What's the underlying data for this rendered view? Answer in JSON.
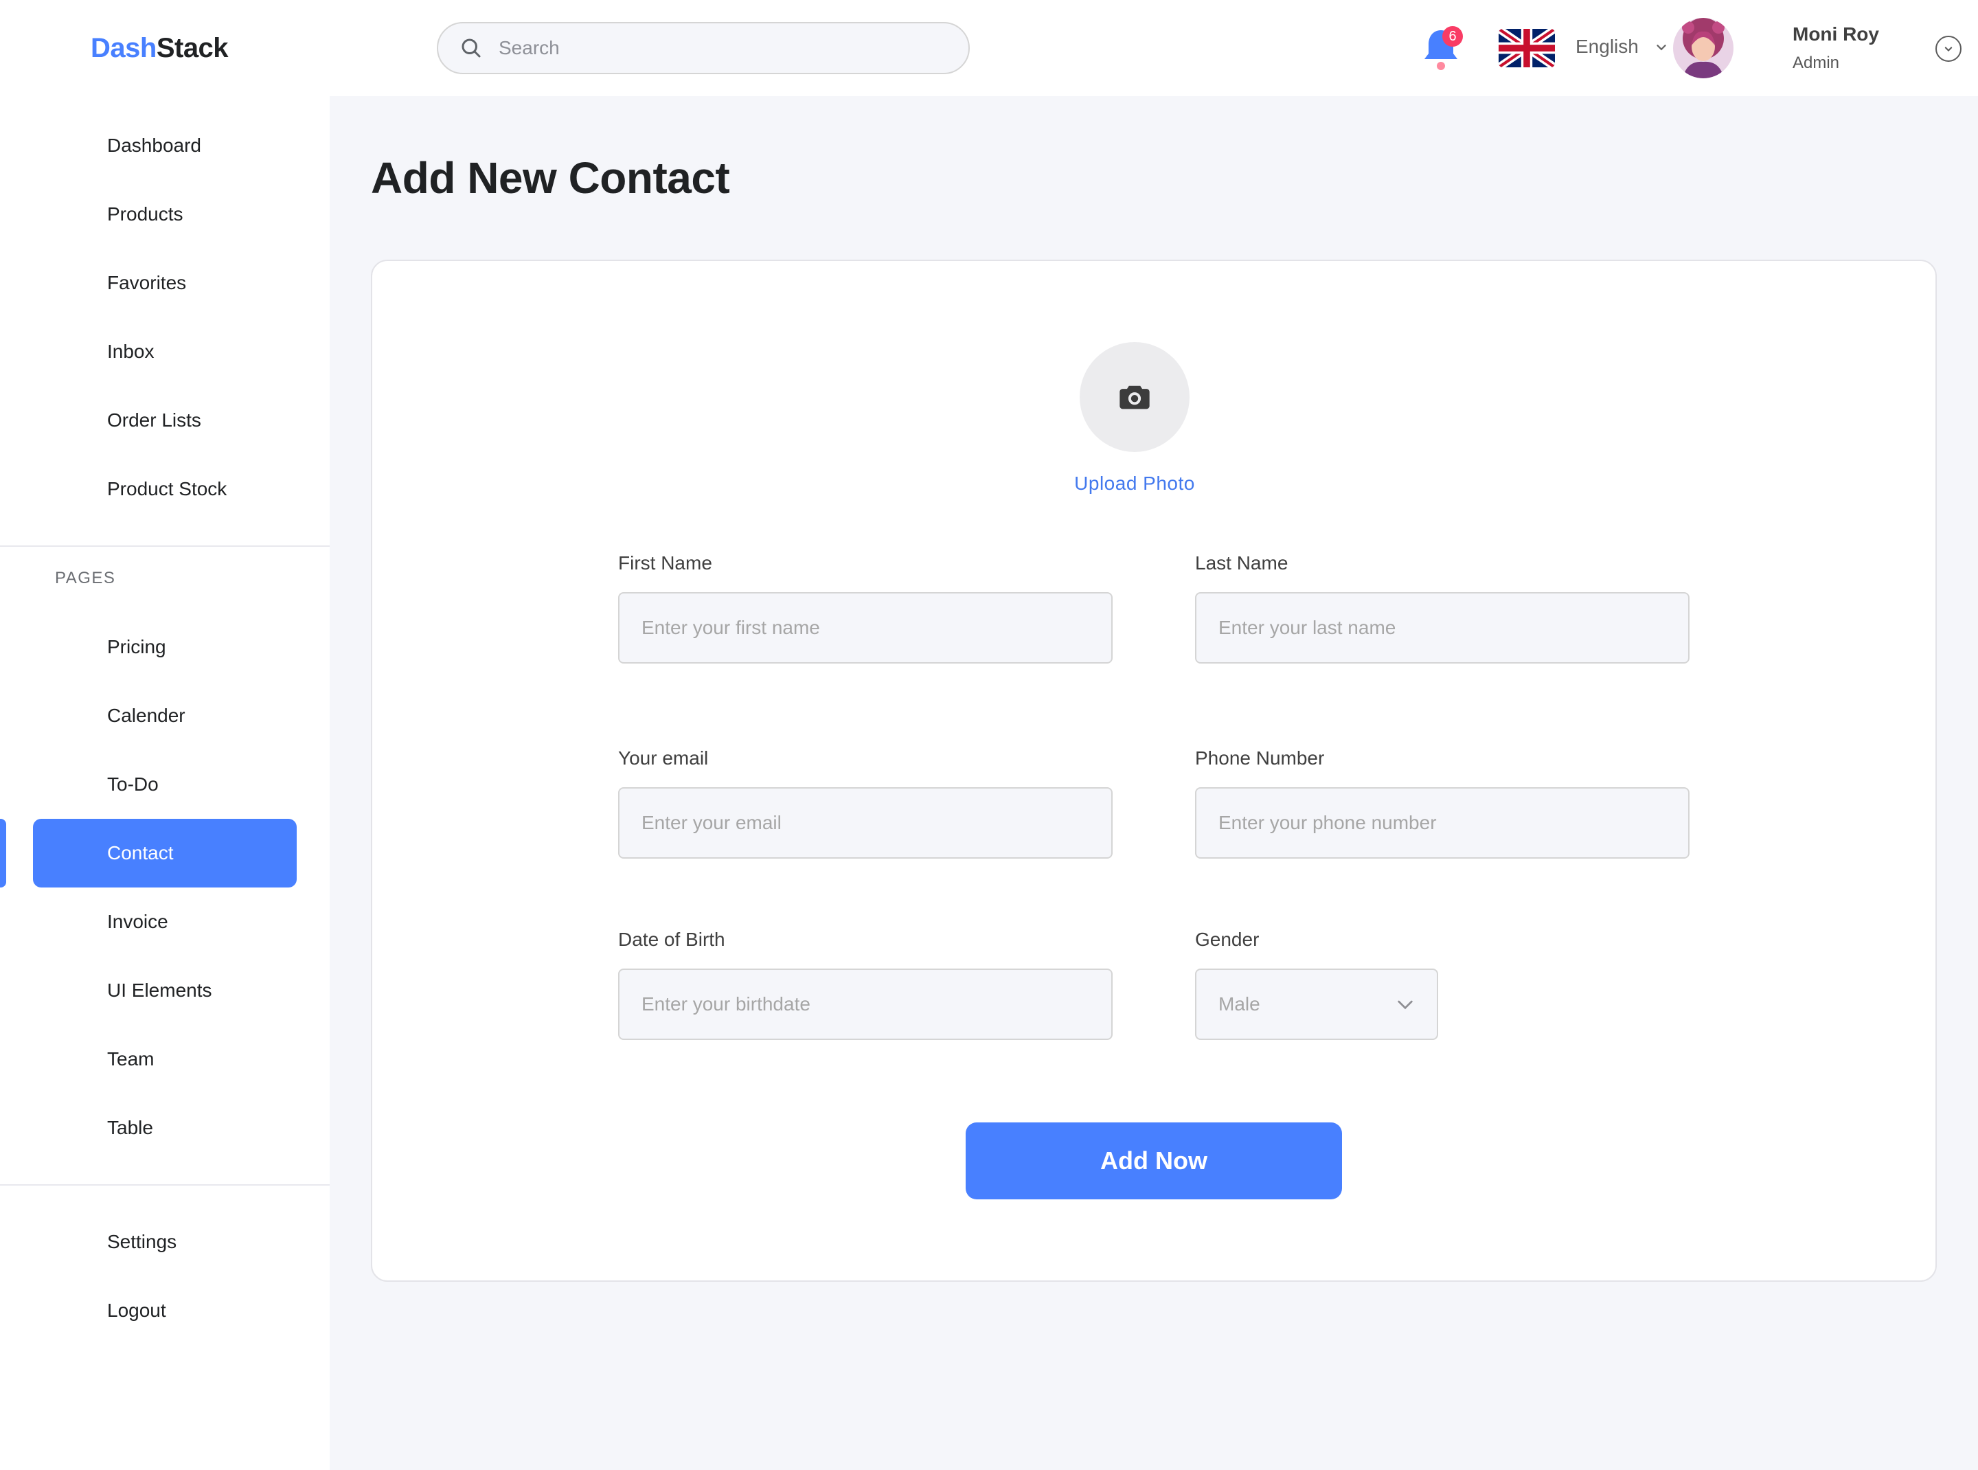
{
  "app": {
    "logo_part1": "Dash",
    "logo_part2": "Stack"
  },
  "sidebar": {
    "main_items": [
      {
        "label": "Dashboard"
      },
      {
        "label": "Products"
      },
      {
        "label": "Favorites"
      },
      {
        "label": "Inbox"
      },
      {
        "label": "Order Lists"
      },
      {
        "label": "Product Stock"
      }
    ],
    "section_label": "PAGES",
    "page_items": [
      {
        "label": "Pricing"
      },
      {
        "label": "Calender"
      },
      {
        "label": "To-Do"
      },
      {
        "label": "Contact",
        "active": true
      },
      {
        "label": "Invoice"
      },
      {
        "label": "UI Elements"
      },
      {
        "label": "Team"
      },
      {
        "label": "Table"
      }
    ],
    "bottom_items": [
      {
        "label": "Settings"
      },
      {
        "label": "Logout"
      }
    ]
  },
  "header": {
    "search": {
      "placeholder": "Search"
    },
    "notifications": {
      "count": "6",
      "icon": "bell-icon"
    },
    "language": {
      "label": "English",
      "flag": "uk-flag-icon"
    },
    "user": {
      "name": "Moni Roy",
      "role": "Admin"
    }
  },
  "main": {
    "title": "Add New Contact",
    "upload_label": "Upload Photo",
    "fields": {
      "first_name": {
        "label": "First Name",
        "placeholder": "Enter your first name"
      },
      "last_name": {
        "label": "Last Name",
        "placeholder": "Enter your last name"
      },
      "email": {
        "label": "Your email",
        "placeholder": "Enter your email"
      },
      "phone": {
        "label": "Phone Number",
        "placeholder": "Enter your phone number"
      },
      "dob": {
        "label": "Date of Birth",
        "placeholder": "Enter your birthdate"
      },
      "gender": {
        "label": "Gender",
        "value": "Male"
      }
    },
    "submit_label": "Add Now"
  },
  "colors": {
    "accent": "#4880FF",
    "badge": "#F93C65",
    "background": "#F5F6FA",
    "link": "#4379EE"
  }
}
